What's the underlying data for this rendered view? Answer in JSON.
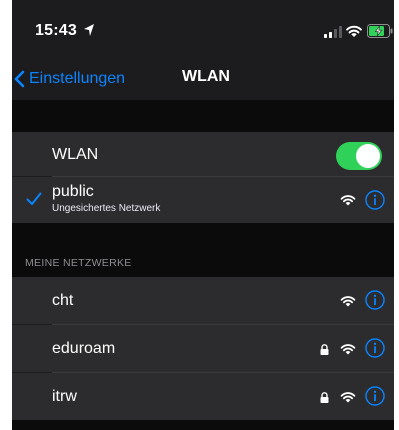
{
  "status_bar": {
    "time": "15:43",
    "icons": [
      "location-arrow-icon",
      "signal-icon",
      "wifi-icon",
      "battery-charging-icon"
    ]
  },
  "nav": {
    "back_label": "Einstellungen",
    "title": "WLAN"
  },
  "wlan_row": {
    "label": "WLAN",
    "enabled": true
  },
  "connected": {
    "name": "public",
    "subtitle": "Ungesichertes Netzwerk"
  },
  "my_networks": {
    "header": "MEINE NETZWERKE",
    "items": [
      {
        "name": "cht",
        "locked": false
      },
      {
        "name": "eduroam",
        "locked": true
      },
      {
        "name": "itrw",
        "locked": true
      }
    ]
  },
  "colors": {
    "accent": "#0a84ff",
    "toggle_on": "#30d158",
    "background": "#1c1c1e",
    "cell": "#2c2c2e"
  }
}
